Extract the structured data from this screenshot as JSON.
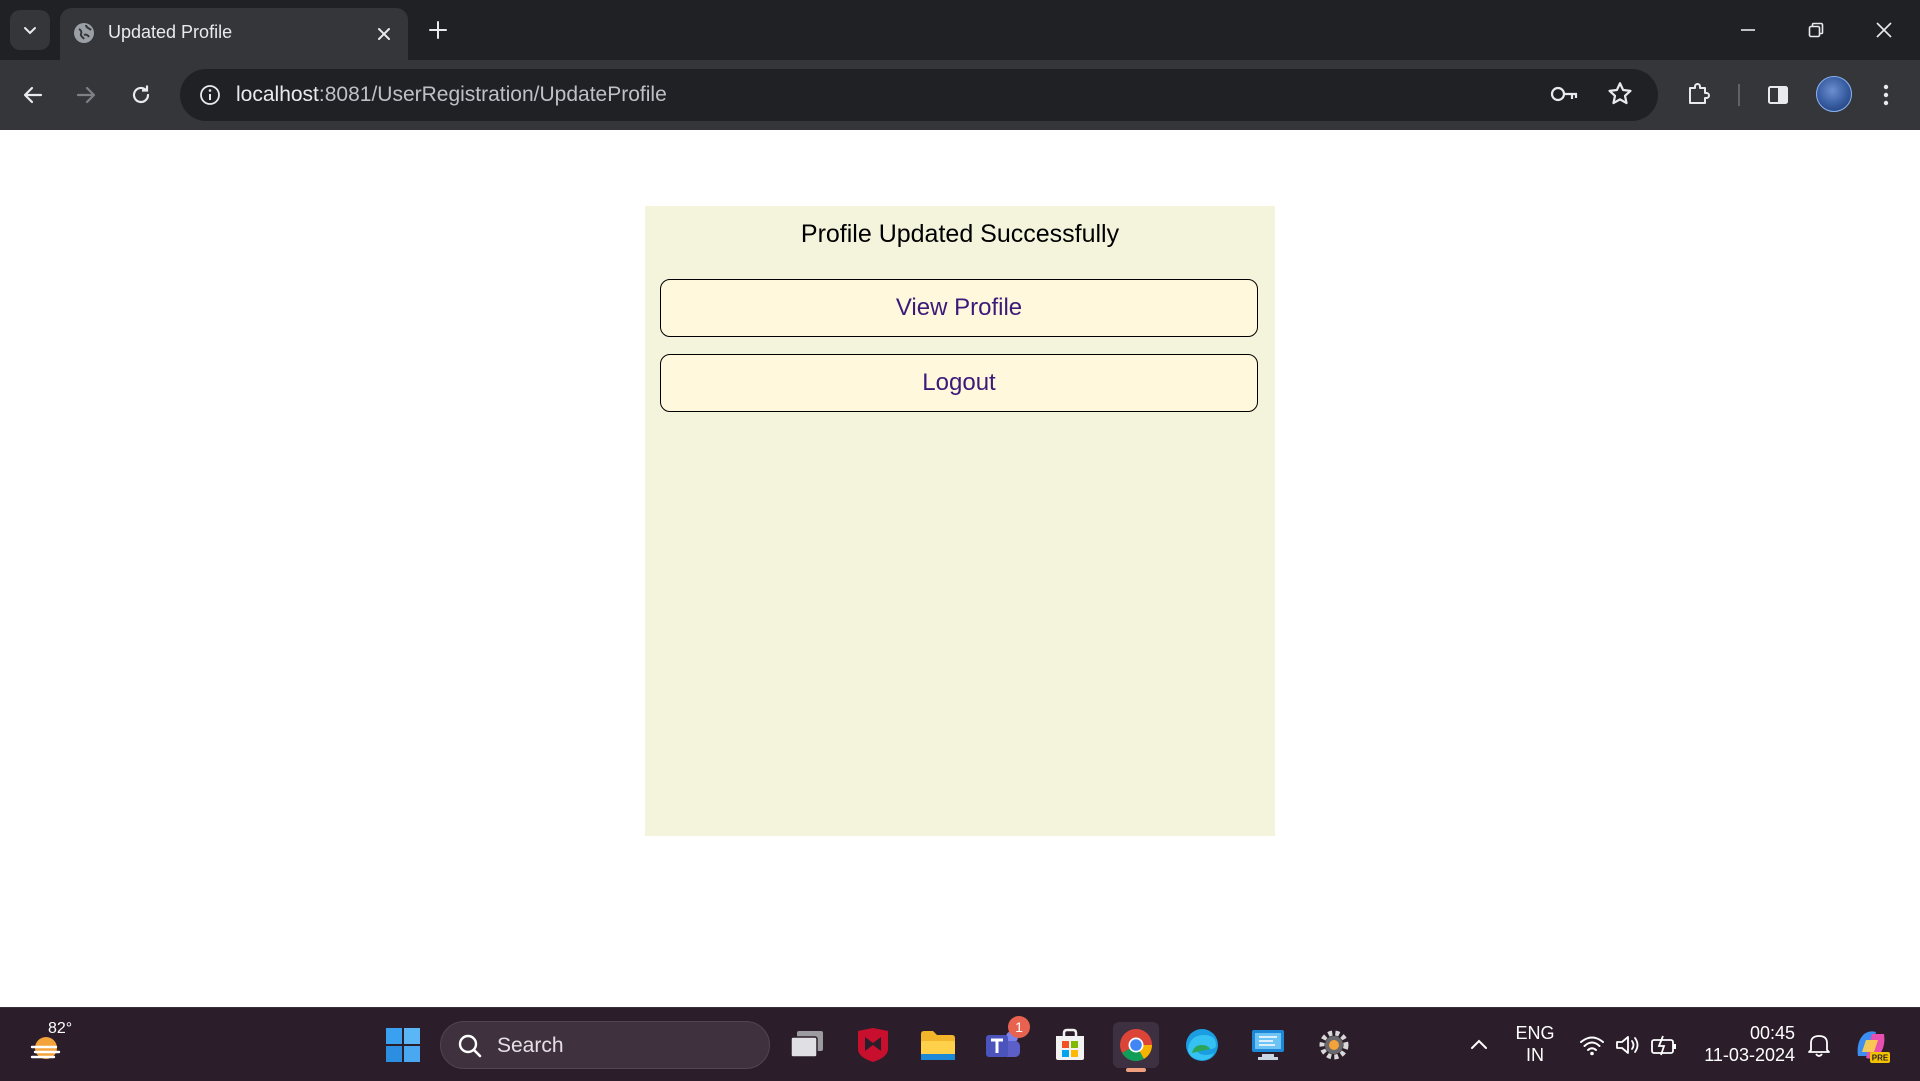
{
  "browser": {
    "tab": {
      "title": "Updated Profile"
    },
    "address": {
      "host": "localhost",
      "rest": ":8081/UserRegistration/UpdateProfile"
    }
  },
  "page": {
    "message": "Profile Updated Successfully",
    "buttons": {
      "view_profile": "View Profile",
      "logout": "Logout"
    },
    "colors": {
      "card_bg": "#f4f4dc",
      "button_bg": "#fff8dc",
      "button_text": "#3b1a7a"
    }
  },
  "taskbar": {
    "weather": {
      "temperature": "82°"
    },
    "search": {
      "placeholder": "Search"
    },
    "teams_badge": "1",
    "language": {
      "line1": "ENG",
      "line2": "IN"
    },
    "clock": {
      "time": "00:45",
      "date": "11-03-2024"
    }
  }
}
